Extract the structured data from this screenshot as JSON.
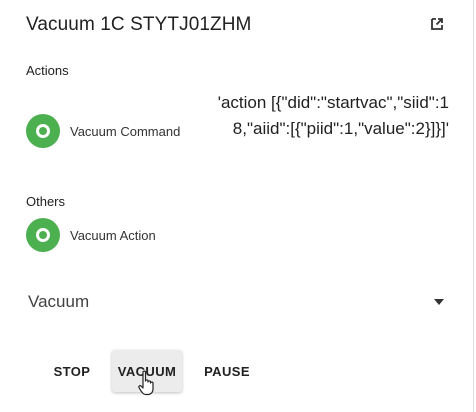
{
  "dialog": {
    "title": "Vacuum 1C STYTJ01ZHM",
    "open_icon": "open-in-new-icon"
  },
  "sections": {
    "actions_label": "Actions",
    "others_label": "Others"
  },
  "actions": [
    {
      "name": "Vacuum Command",
      "value": "'action [{\"did\":\"startvac\",\"siid\":18,\"aiid\":[{\"piid\":1,\"value\":2}]}]'",
      "icon": "circle-icon",
      "icon_color": "#4caf50"
    }
  ],
  "others": [
    {
      "name": "Vacuum Action",
      "icon": "circle-icon",
      "icon_color": "#4caf50"
    }
  ],
  "select": {
    "value": "Vacuum",
    "icon": "chevron-down-icon"
  },
  "buttons": {
    "stop": "STOP",
    "vacuum": "VACUUM",
    "pause": "PAUSE"
  }
}
